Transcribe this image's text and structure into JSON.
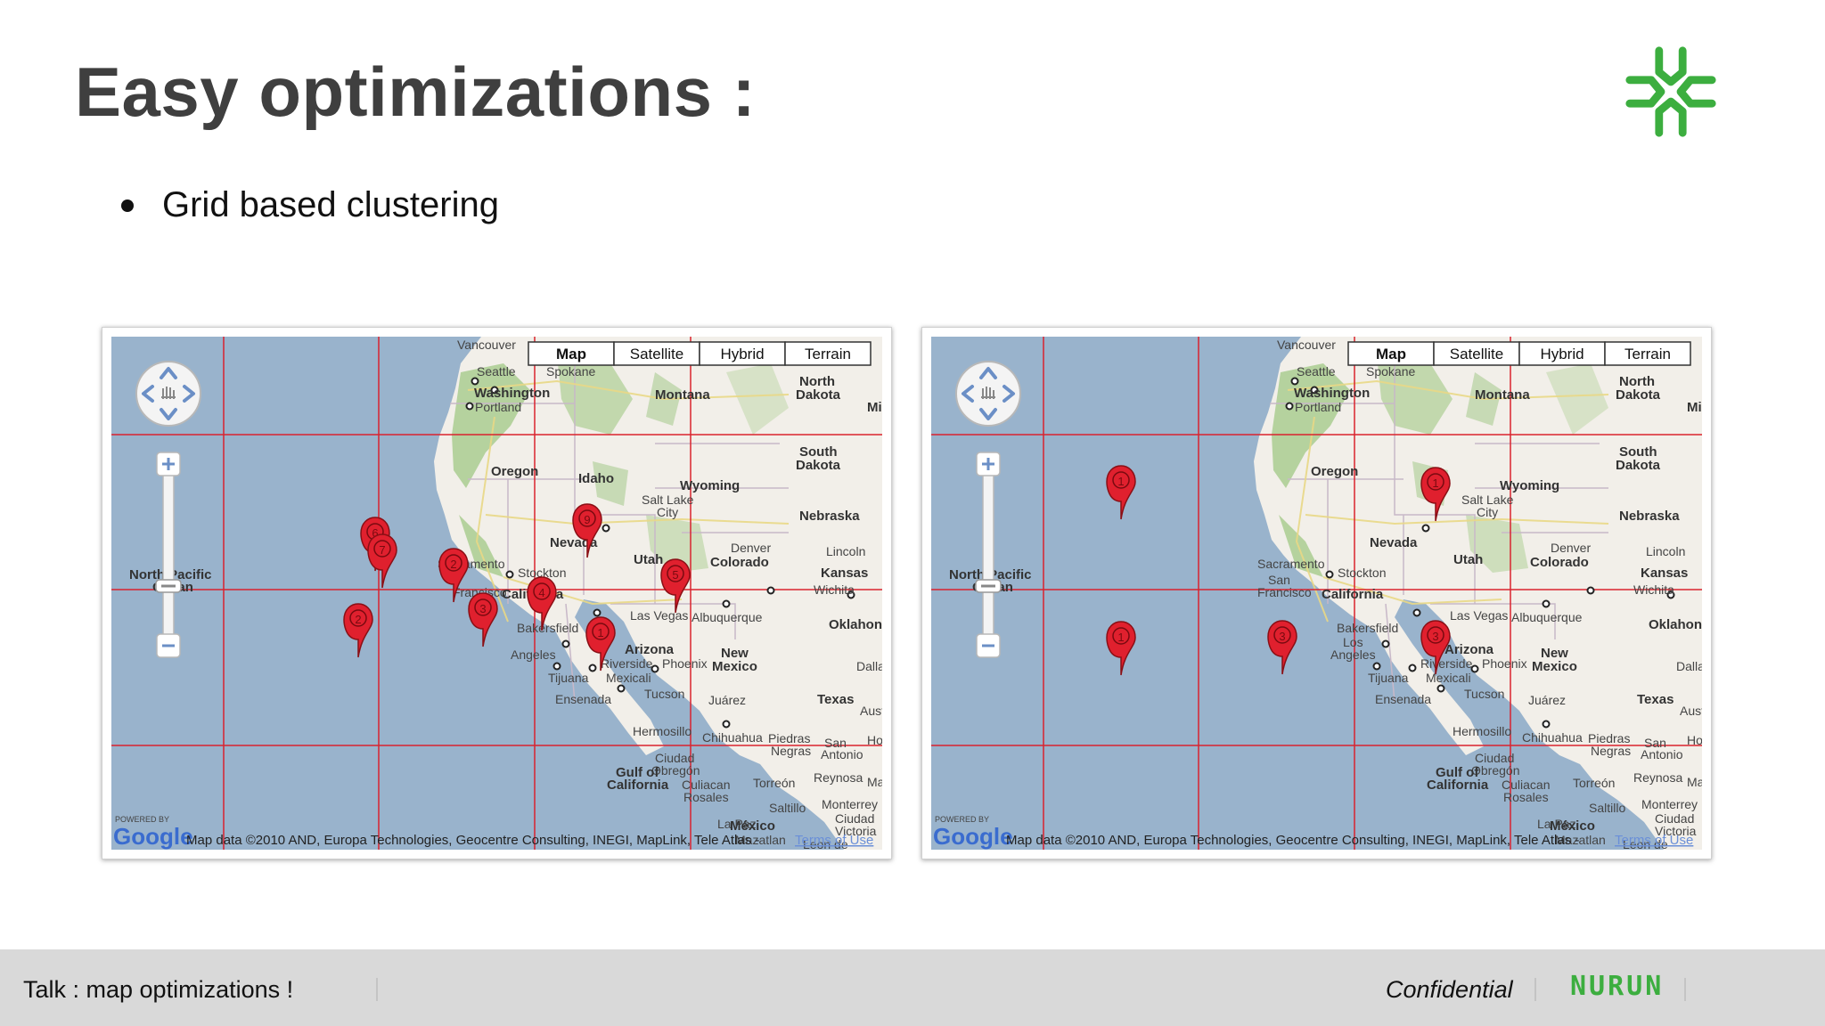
{
  "slide": {
    "title": "Easy optimizations :",
    "bullet": "Grid based clustering"
  },
  "colors": {
    "title": "#3f3f3f",
    "logo_green": "#3cae3f",
    "marker_red": "#e0202e",
    "grid_red": "#d9232e",
    "ocean": "#99b3cc",
    "land": "#f2efe9",
    "forest": "#b5d29e"
  },
  "maps": {
    "map_types": [
      "Map",
      "Satellite",
      "Hybrid",
      "Terrain"
    ],
    "attribution": "Map data ©2010 AND, Europa Technologies, Geocentre Consulting, INEGI, MapLink, Tele Atlas -",
    "terms": "Terms of Use",
    "powered_by": "POWERED BY",
    "google": "Google",
    "labels": {
      "vancouver": "Vancouver",
      "seattle": "Seattle",
      "spokane": "Spokane",
      "washington": "Washington",
      "portland": "Portland",
      "oregon": "Oregon",
      "idaho": "Idaho",
      "montana": "Montana",
      "wyoming": "Wyoming",
      "north_dakota_1": "North",
      "north_dakota_2": "Dakota",
      "south_dakota_1": "South",
      "south_dakota_2": "Dakota",
      "mi": "Mi",
      "nebraska": "Nebraska",
      "lincoln": "Lincoln",
      "nevada": "Nevada",
      "utah": "Utah",
      "salt_lake_1": "Salt Lake",
      "salt_lake_2": "City",
      "denver": "Denver",
      "colorado": "Colorado",
      "kansas": "Kansas",
      "wichita": "Wichita",
      "sacramento": "Sacramento",
      "stockton": "Stockton",
      "san_francisco_1": "San",
      "san_francisco_2": "Francisco",
      "california": "California",
      "las_vegas": "Las Vegas",
      "albuquerque": "Albuquerque",
      "oklahoma": "Oklahon",
      "bakersfield": "Bakersfield",
      "los_angeles_1": "Los",
      "los_angeles_2": "Angeles",
      "riverside": "Riverside",
      "phoenix": "Phoenix",
      "arizona": "Arizona",
      "new_mexico_1": "New",
      "new_mexico_2": "Mexico",
      "dallas": "Dallas",
      "tijuana": "Tijuana",
      "mexicali": "Mexicali",
      "ensenada": "Ensenada",
      "tucson": "Tucson",
      "juarez": "Juárez",
      "texas": "Texas",
      "austin": "Aust",
      "hermosillo": "Hermosillo",
      "chihuahua": "Chihuahua",
      "piedras_negras_1": "Piedras",
      "piedras_negras_2": "Negras",
      "san_antonio_1": "San",
      "san_antonio_2": "Antonio",
      "ciudad_obregon_1": "Ciudad",
      "ciudad_obregon_2": "Obregón",
      "gulf_1": "Gulf of",
      "gulf_2": "California",
      "culiacan_1": "Culiacan",
      "culiacan_2": "Rosales",
      "torreon": "Torreón",
      "reynosa": "Reynosa",
      "saltillo": "Saltillo",
      "monterrey": "Monterrey",
      "la_paz": "La Paz",
      "mexico": "México",
      "mazatlan": "Mazatlan",
      "leon": "Leon de",
      "ciudad_victoria_1": "Ciudad",
      "ciudad_victoria_2": "Victoria",
      "north_pacific_1": "North Pacific",
      "north_pacific_2": "Ocean",
      "houston": "Ho",
      "mat": "Mat"
    },
    "left_markers": [
      {
        "label": "6"
      },
      {
        "label": "7"
      },
      {
        "label": "2"
      },
      {
        "label": "3"
      },
      {
        "label": "9"
      },
      {
        "label": "4"
      },
      {
        "label": "5"
      },
      {
        "label": "1"
      },
      {
        "label": "2"
      }
    ],
    "right_markers": [
      {
        "label": "1"
      },
      {
        "label": "1"
      },
      {
        "label": "1"
      },
      {
        "label": "3"
      },
      {
        "label": "3"
      }
    ]
  },
  "footer": {
    "talk": "Talk : map optimizations !",
    "confidential": "Confidential",
    "brand": "NURUN"
  }
}
